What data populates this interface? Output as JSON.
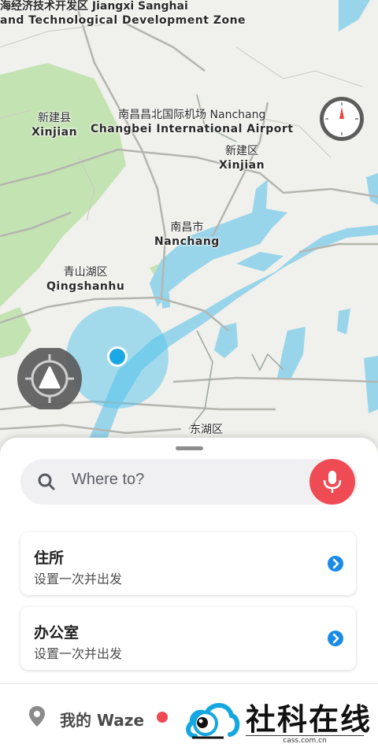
{
  "map": {
    "labels": [
      {
        "cn": "海经济技术开发区 Jiangxi Sanghai",
        "en": "and Technological Development Zone"
      },
      {
        "cn": "新建县",
        "en": "Xinjian"
      },
      {
        "cn": "南昌昌北国际机场 Nanchang",
        "en": "Changbei International Airport"
      },
      {
        "cn": "新建区",
        "en": "Xinjian"
      },
      {
        "cn": "南昌市",
        "en": "Nanchang"
      },
      {
        "cn": "青山湖区",
        "en": "Qingshanhu"
      },
      {
        "cn": "东湖区",
        "en": ""
      }
    ],
    "colors": {
      "water": "#99d5ea",
      "park": "#c4e3b2",
      "road": "#b8b8b8",
      "land": "#f0f0ec",
      "location": "#1aa7e6"
    }
  },
  "controls": {
    "compass_icon": "compass-icon",
    "recenter_icon": "recenter-icon"
  },
  "search": {
    "placeholder": "Where to?",
    "icon": "search-icon",
    "mic_icon": "microphone-icon"
  },
  "places": [
    {
      "title": "住所",
      "subtitle": "设置一次并出发",
      "icon": "chevron-right-circle-icon"
    },
    {
      "title": "办公室",
      "subtitle": "设置一次并出发",
      "icon": "chevron-right-circle-icon"
    }
  ],
  "bottom_bar": {
    "my_waze_label": "我的 Waze",
    "pin_icon": "location-pin-icon",
    "status_color": "#ef4b54"
  },
  "watermark": {
    "title": "社科在线",
    "subtitle": "cass.com.cn"
  }
}
